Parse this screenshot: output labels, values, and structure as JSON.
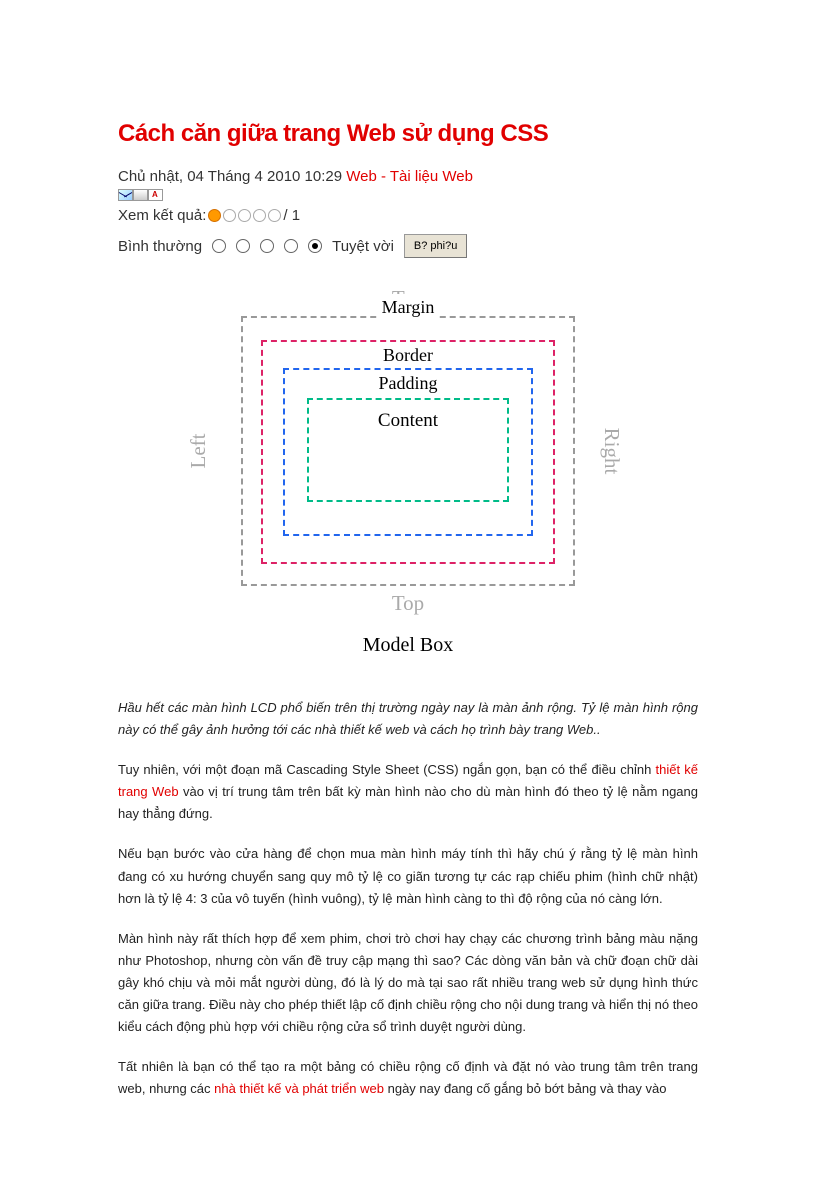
{
  "title": "Cách căn giữa trang Web sử dụng CSS",
  "dateline": {
    "date": "Chủ nhật, 04 Tháng 4 2010 10:29",
    "crumb1": "Web",
    "sep": " - ",
    "crumb2": "Tài liệu Web"
  },
  "result": {
    "label": "Xem kết quả:",
    "tail": " / 1"
  },
  "rating": {
    "left": "Bình thường",
    "right": "Tuyệt vời",
    "button": "B? phi?u"
  },
  "diagram": {
    "top": "Top",
    "bottom": "Top",
    "left": "Left",
    "right": "Right",
    "margin": "Margin",
    "border": "Border",
    "padding": "Padding",
    "content": "Content",
    "caption": "Model Box"
  },
  "para": {
    "intro": "Hầu hết các màn hình LCD phổ biến trên thị trường ngày nay là màn ảnh rộng. Tỷ lệ màn hình rộng này có thể gây ảnh hưởng tới các nhà thiết kế web và cách họ trình bày trang Web..",
    "p2a": "Tuy nhiên, với một đoạn mã Cascading Style Sheet (CSS) ngắn gọn, bạn có thể điều chỉnh ",
    "p2link": "thiết kế trang Web",
    "p2b": " vào vị trí trung tâm trên bất kỳ màn hình nào cho dù màn hình đó theo tỷ lệ nằm ngang hay thẳng đứng.",
    "p3": "Nếu bạn bước vào cửa hàng để chọn mua màn hình máy tính thì hãy chú ý rằng tỷ lệ màn hình đang có xu hướng chuyển sang quy mô tỷ lệ co giãn tương tự các rạp chiếu phim (hình chữ nhật) hơn là tỷ lệ 4: 3 của vô tuyến (hình vuông), tỷ lệ màn hình càng to thì độ rộng của nó càng lớn.",
    "p4": "Màn hình này rất thích hợp để xem phim, chơi trò chơi hay chạy các chương trình bảng màu nặng như Photoshop, nhưng còn vấn đề truy cập mạng thì sao? Các dòng văn bản và chữ đoạn chữ dài gây khó chịu và mỏi mắt người dùng, đó là lý do mà tại sao rất nhiều trang web sử dụng hình thức căn giữa trang. Điều này cho phép thiết lập cố định chiều rộng cho nội dung trang và hiển thị nó theo kiểu cách động phù hợp với chiều rộng cửa sổ trình duyệt người dùng.",
    "p5a": "Tất nhiên là bạn có thể tạo ra một bảng có chiều rộng cố định và đặt nó vào trung tâm trên trang web, nhưng các ",
    "p5link": "nhà thiết kế và phát triển web",
    "p5b": " ngày nay đang cố gắng bỏ bớt bảng và thay vào"
  }
}
